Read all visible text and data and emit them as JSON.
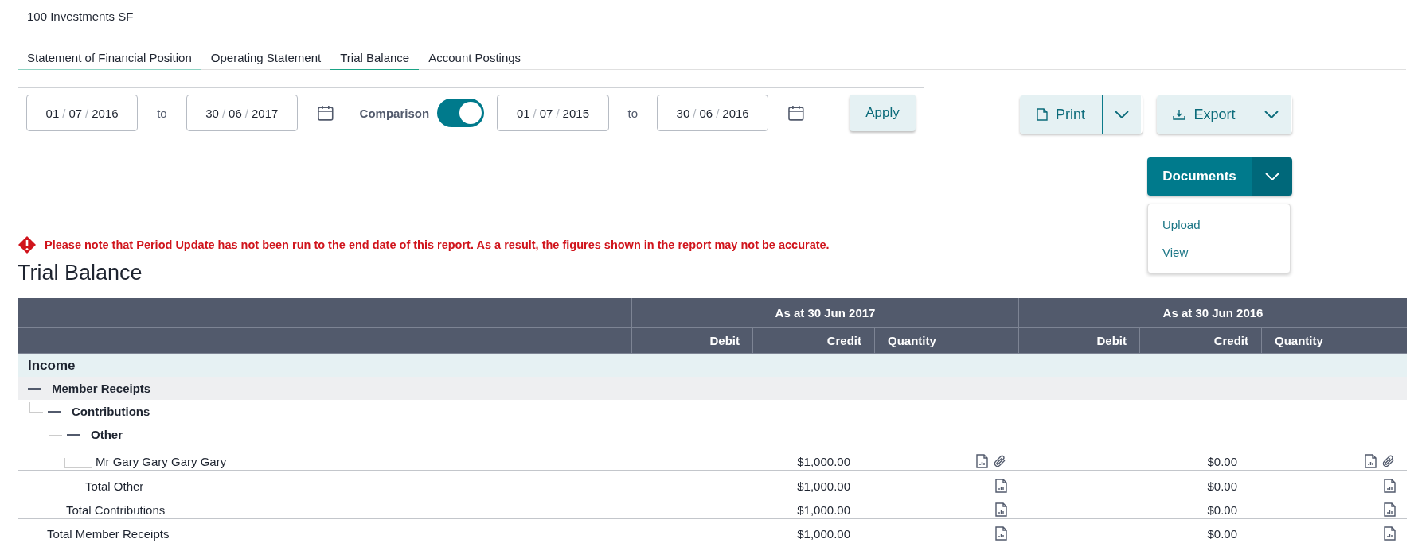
{
  "fund": {
    "name": "100 Investments SF"
  },
  "tabs": [
    {
      "label": "Statement of Financial Position",
      "selected": false,
      "focused": true
    },
    {
      "label": "Operating Statement",
      "selected": false,
      "focused": false
    },
    {
      "label": "Trial Balance",
      "selected": true,
      "focused": false
    },
    {
      "label": "Account Postings",
      "selected": false,
      "focused": false
    }
  ],
  "filters": {
    "date_separator": "/",
    "from": {
      "day": "01",
      "month": "07",
      "year": "2016"
    },
    "to_label": "to",
    "to": {
      "day": "30",
      "month": "06",
      "year": "2017"
    },
    "comparison": {
      "label": "Comparison",
      "on": true
    },
    "compare_from": {
      "day": "01",
      "month": "07",
      "year": "2015"
    },
    "compare_to_label": "to",
    "compare_to": {
      "day": "30",
      "month": "06",
      "year": "2016"
    },
    "apply_button": "Apply"
  },
  "actions": {
    "print": "Print",
    "export": "Export",
    "documents": {
      "label": "Documents",
      "expanded": true,
      "menu": [
        "Upload",
        "View"
      ]
    }
  },
  "warning": "Please note that Period Update has not been run to the end date of this report. As a result, the figures shown in the report may not be accurate.",
  "report_title": "Trial Balance",
  "table": {
    "periods": [
      {
        "title": "As at 30 Jun 2017",
        "columns": [
          "Debit",
          "Credit",
          "Quantity"
        ]
      },
      {
        "title": "As at 30 Jun 2016",
        "columns": [
          "Debit",
          "Credit",
          "Quantity"
        ]
      }
    ],
    "sections": [
      {
        "title": "Income",
        "groups": [
          {
            "kind": "group",
            "label": "Member Receipts",
            "expanded": true,
            "children": [
              {
                "kind": "group",
                "label": "Contributions",
                "expanded": true,
                "children": [
                  {
                    "kind": "group",
                    "label": "Other",
                    "expanded": true,
                    "children": [
                      {
                        "kind": "account",
                        "label": "Mr Gary Gary Gary Gary",
                        "values": [
                          {
                            "credit": "$1,000.00",
                            "attachment": true
                          },
                          {
                            "credit": "$0.00",
                            "attachment": true
                          }
                        ]
                      }
                    ],
                    "total": {
                      "label": "Total Other",
                      "values": [
                        {
                          "credit": "$1,000.00",
                          "attachment": false
                        },
                        {
                          "credit": "$0.00",
                          "attachment": false
                        }
                      ]
                    }
                  }
                ],
                "total": {
                  "label": "Total Contributions",
                  "values": [
                    {
                      "credit": "$1,000.00",
                      "attachment": false
                    },
                    {
                      "credit": "$0.00",
                      "attachment": false
                    }
                  ]
                }
              }
            ],
            "total": {
              "label": "Total Member Receipts",
              "values": [
                {
                  "credit": "$1,000.00",
                  "attachment": false
                },
                {
                  "credit": "$0.00",
                  "attachment": false
                }
              ]
            }
          }
        ]
      }
    ]
  }
}
